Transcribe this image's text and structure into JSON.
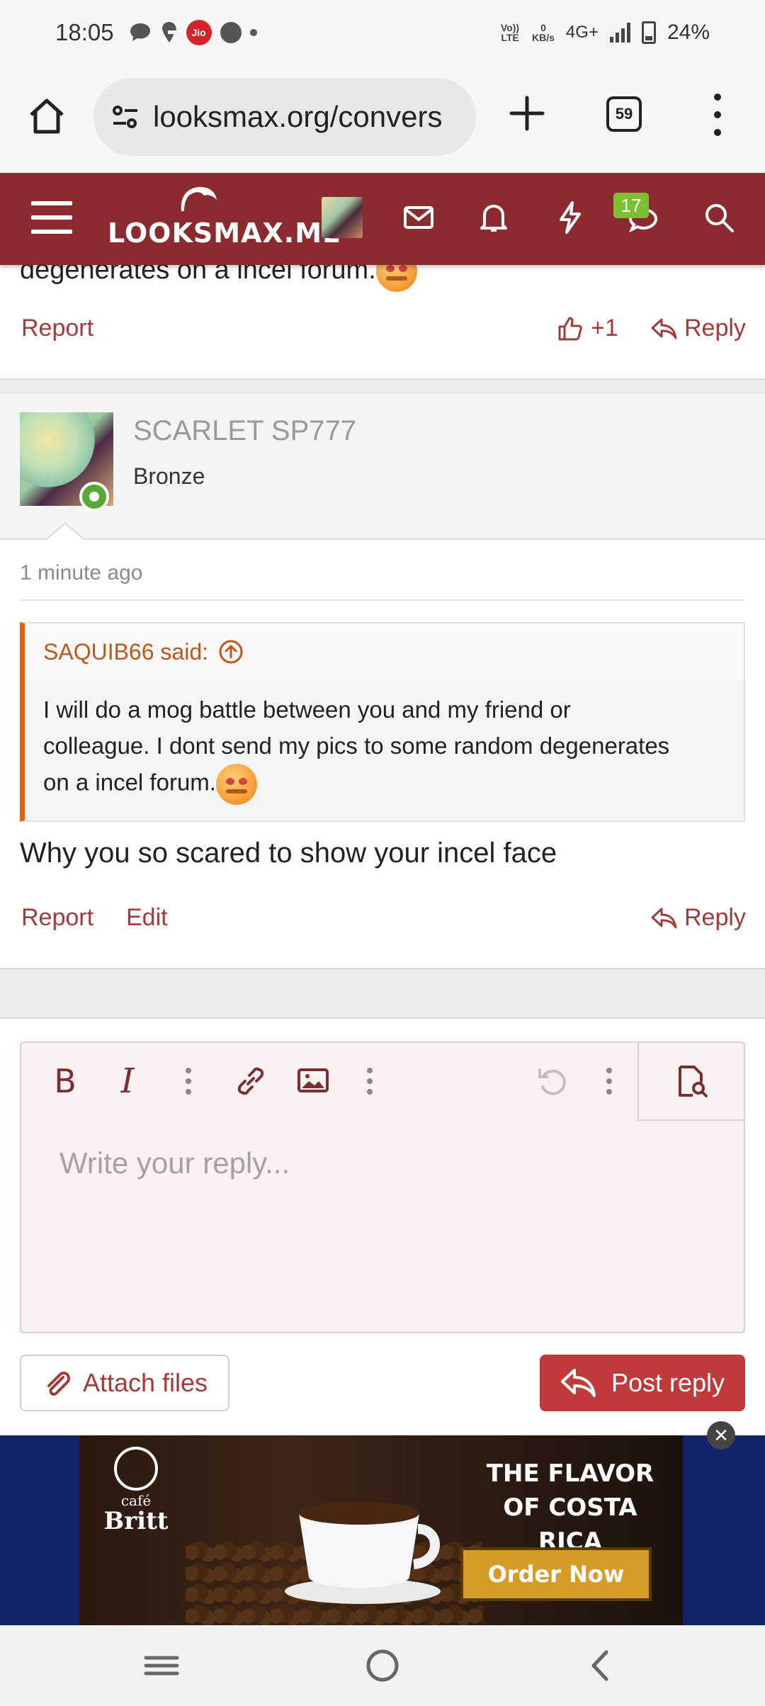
{
  "status_bar": {
    "time": "18:05",
    "jio": "Jio",
    "volte": "Vo)) LTE",
    "speed_value": "0",
    "speed_unit": "KB/s",
    "network": "4G+",
    "battery": "24%"
  },
  "browser": {
    "url": "looksmax.org/convers",
    "tab_count": "59",
    "icons": [
      "home-icon",
      "site-settings-icon",
      "plus-icon",
      "tabs-icon",
      "more-vert-icon"
    ]
  },
  "site_header": {
    "logo_text": "LOOKSMAX.ME",
    "conversations_badge": "17",
    "icons": [
      "menu-icon",
      "avatar",
      "mail-icon",
      "bell-icon",
      "bolt-icon",
      "conversations-icon",
      "search-icon"
    ]
  },
  "previous_post": {
    "text_fragment": "degenerates on a incel forum.",
    "report_label": "Report",
    "like_label": "+1",
    "reply_label": "Reply"
  },
  "post": {
    "username": "SCARLET SP777",
    "rank": "Bronze",
    "timestamp": "1 minute ago",
    "quote": {
      "author_said": "SAQUIB66 said:",
      "line1": "I will do a mog battle between you and my friend or",
      "line2": "colleague. I dont send my pics to some random degenerates",
      "line3": "on a incel forum."
    },
    "message": "Why you so scared to show your incel face",
    "report_label": "Report",
    "edit_label": "Edit",
    "reply_label": "Reply"
  },
  "editor": {
    "placeholder": "Write your reply...",
    "bold": "B",
    "italic": "I",
    "attach_label": "Attach files",
    "post_label": "Post reply"
  },
  "ad": {
    "brand_small": "café",
    "brand_name": "Britt",
    "headline1": "THE FLAVOR",
    "headline2": "OF COSTA RICA",
    "cta": "Order Now",
    "close": "✕"
  },
  "colors": {
    "brand": "#8b2b2f",
    "accent_link": "#a33a3a",
    "quote_border": "#d9671a",
    "post_button": "#c13a3a",
    "badge": "#7cc032"
  }
}
